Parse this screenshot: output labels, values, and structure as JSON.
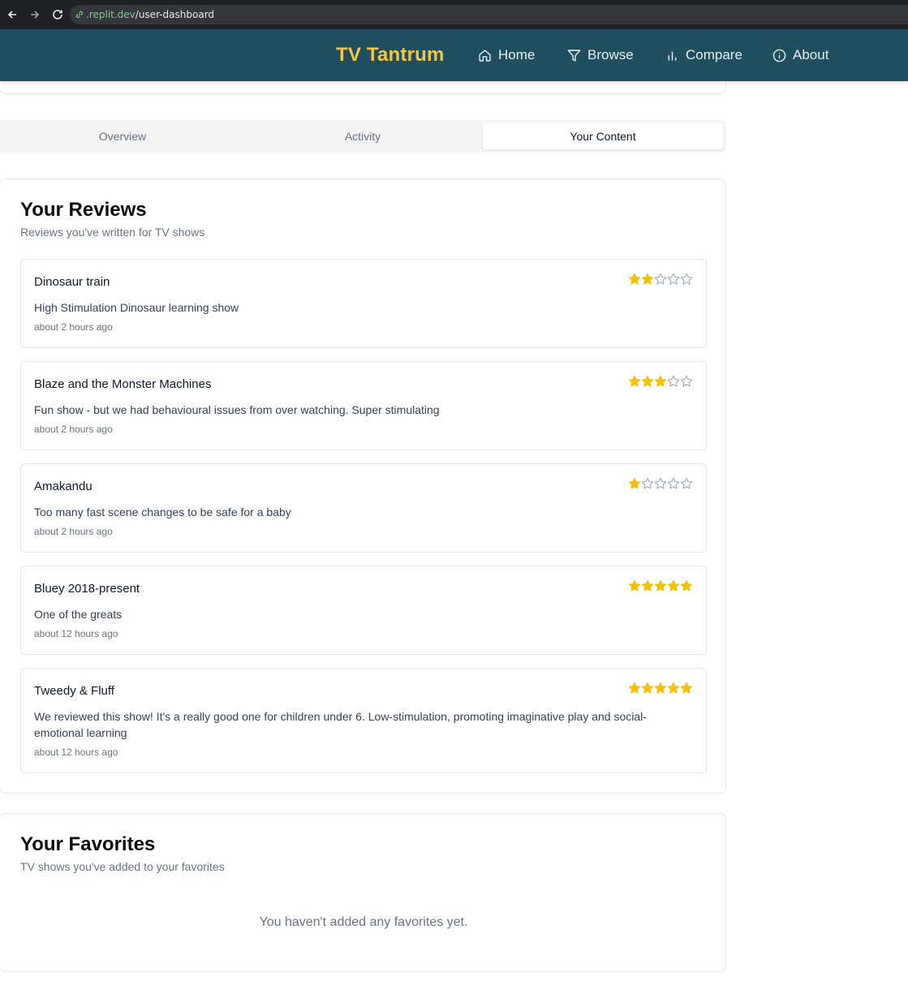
{
  "browser": {
    "url_host": ".replit.dev",
    "url_path": "/user-dashboard"
  },
  "header": {
    "brand": "TV Tantrum",
    "nav": [
      {
        "label": "Home",
        "icon": "home-icon"
      },
      {
        "label": "Browse",
        "icon": "filter-icon"
      },
      {
        "label": "Compare",
        "icon": "bar-chart-icon"
      },
      {
        "label": "About",
        "icon": "info-icon"
      }
    ]
  },
  "tabs": [
    {
      "label": "Overview",
      "active": false
    },
    {
      "label": "Activity",
      "active": false
    },
    {
      "label": "Your Content",
      "active": true
    }
  ],
  "reviews": {
    "title": "Your Reviews",
    "subtitle": "Reviews you've written for TV shows",
    "star_color": "#f4c20d",
    "items": [
      {
        "show": "Dinosaur train",
        "text": "High Stimulation Dinosaur learning show",
        "time": "about 2 hours ago",
        "rating": 2
      },
      {
        "show": "Blaze and the Monster Machines",
        "text": "Fun show - but we had behavioural issues from over watching. Super stimulating",
        "time": "about 2 hours ago",
        "rating": 3
      },
      {
        "show": "Amakandu",
        "text": "Too many fast scene changes to be safe for a baby",
        "time": "about 2 hours ago",
        "rating": 1
      },
      {
        "show": "Bluey 2018-present",
        "text": "One of the greats",
        "time": "about 12 hours ago",
        "rating": 5
      },
      {
        "show": "Tweedy & Fluff",
        "text": "We reviewed this show! It's a really good one for children under 6. Low-stimulation, promoting imaginative play and social-emotional learning",
        "time": "about 12 hours ago",
        "rating": 5
      }
    ]
  },
  "favorites": {
    "title": "Your Favorites",
    "subtitle": "TV shows you've added to your favorites",
    "empty": "You haven't added any favorites yet."
  }
}
